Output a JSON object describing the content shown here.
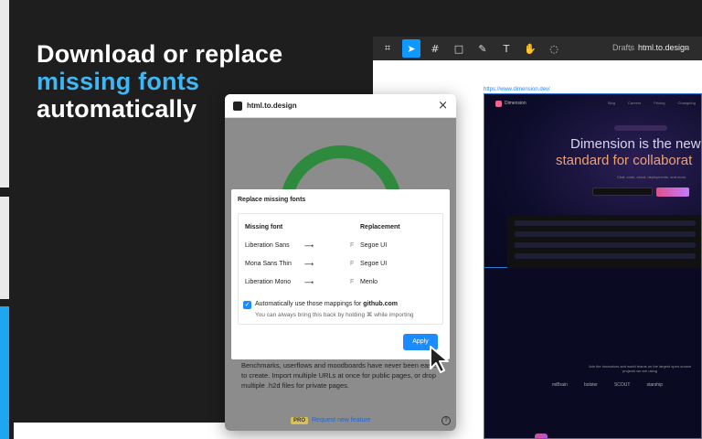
{
  "hero": {
    "line1": "Download or replace",
    "line2": "missing fonts",
    "line3": "automatically"
  },
  "figma": {
    "drafts": "Drafts",
    "separator": "/",
    "file_name": "html.to.design",
    "frame_label": "https://www.dimension.dev/"
  },
  "site": {
    "brand": "Dimension",
    "nav": [
      "Blog",
      "Careers",
      "Pricing",
      "Changelog"
    ],
    "heading_line1": "Dimension is the new",
    "heading_line2": "standard for collaborat",
    "subtitle": "Chat, code, cloud, deployments, and more.",
    "mid_text": "Join the innovators and world teams on the largest open-source projects we are using",
    "logos": [
      "miBrain",
      "bolster",
      "SCOUT",
      "starship"
    ]
  },
  "plugin": {
    "title": "html.to.design",
    "description": "Benchmarks, userflows and moodboards have never been easier to create. Import multiple URLs at once for public pages, or drop multiple .h2d files for private pages.",
    "pro_label": "PRO",
    "request_label": "Request new feature",
    "help": "?"
  },
  "dialog": {
    "title": "Replace missing fonts",
    "col_missing": "Missing font",
    "col_replacement": "Replacement",
    "rows": [
      {
        "missing": "Liberation Sans",
        "replacement": "Segoe UI"
      },
      {
        "missing": "Mona Sans Thin",
        "replacement": "Segoe UI"
      },
      {
        "missing": "Liberation Mono",
        "replacement": "Menlo"
      }
    ],
    "arrow_glyph": "⟶",
    "font_glyph": "F",
    "checkbox_checked": true,
    "checkbox_prefix": "Automatically use those mappings for",
    "checkbox_domain": "github.com",
    "checkbox_sub": "You can always bring this back by holding ⌘ while importing",
    "apply_label": "Apply"
  },
  "colors": {
    "accent": "#3fb7f5",
    "primary_button": "#1a8cff",
    "ring": "#2e8b3e",
    "figma_toolbar": "#2c2c2c"
  }
}
